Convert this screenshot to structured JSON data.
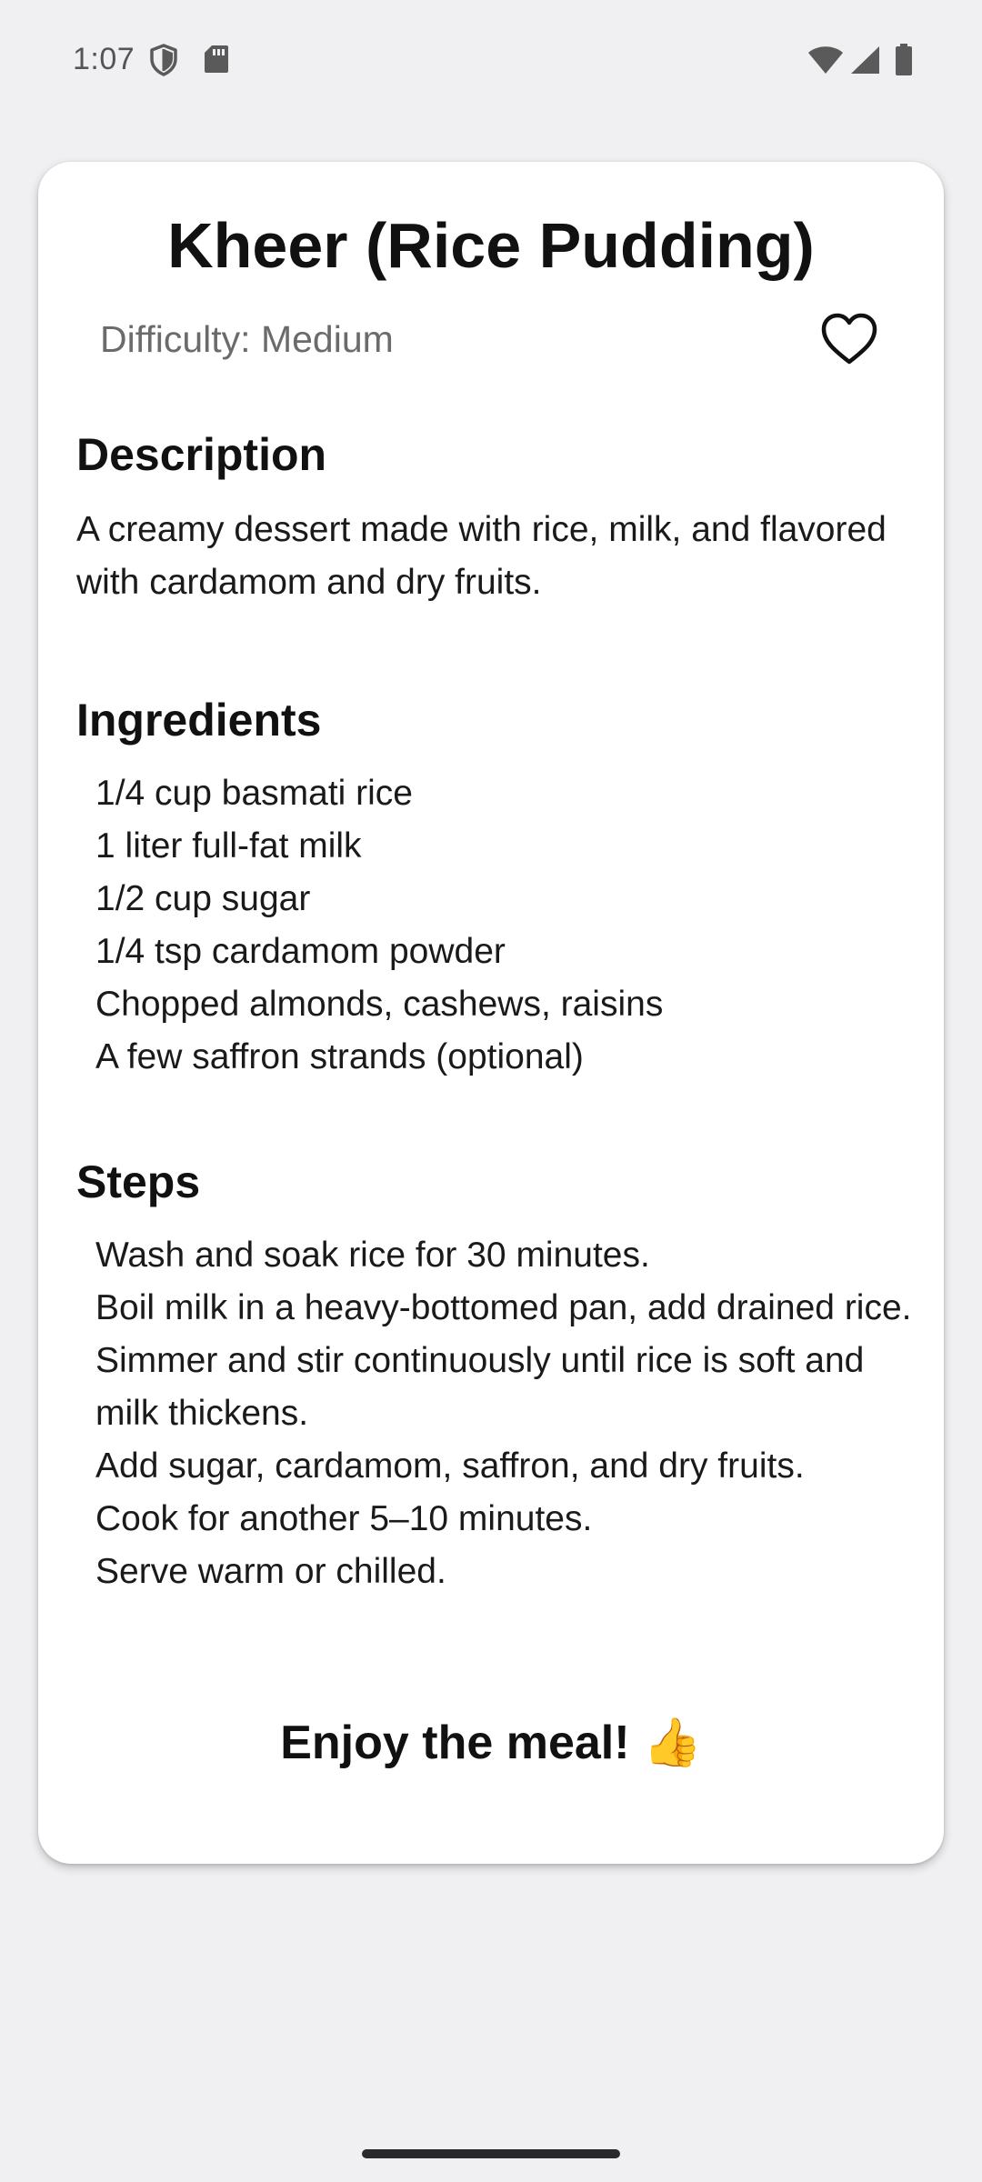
{
  "status_bar": {
    "time": "1:07",
    "icons": [
      "shield-icon",
      "sd-card-icon",
      "wifi-icon",
      "cellular-signal-icon",
      "battery-icon"
    ]
  },
  "recipe": {
    "title": "Kheer (Rice Pudding)",
    "difficulty": "Difficulty: Medium",
    "favorite_icon": "heart-outline-icon",
    "description_heading": "Description",
    "description": "A creamy dessert made with rice, milk, and flavored with cardamom and dry fruits.",
    "ingredients_heading": "Ingredients",
    "ingredients": [
      "1/4 cup basmati rice",
      "1 liter full-fat milk",
      "1/2 cup sugar",
      "1/4 tsp cardamom powder",
      "Chopped almonds, cashews, raisins",
      "A few saffron strands (optional)"
    ],
    "steps_heading": "Steps",
    "steps": [
      "Wash and soak rice for 30 minutes.",
      "Boil milk in a heavy-bottomed pan, add drained rice.",
      "Simmer and stir continuously until rice is soft and milk thickens.",
      "Add sugar, cardamom, saffron, and dry fruits.",
      "Cook for another 5–10 minutes.",
      "Serve warm or chilled."
    ],
    "footer_message": "Enjoy the meal! 👍"
  },
  "colors": {
    "background": "#f0eff1",
    "card": "#ffffff",
    "text": "#111111",
    "muted_text": "#6b6b6b"
  }
}
